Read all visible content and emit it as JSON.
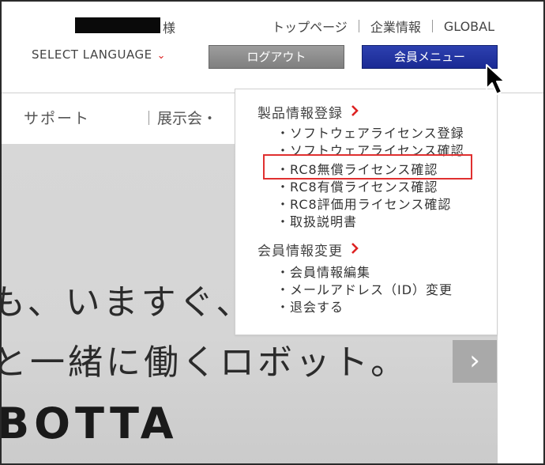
{
  "header": {
    "honorific": "様",
    "links": [
      "トップページ",
      "企業情報",
      "GLOBAL"
    ],
    "language_label": "SELECT LANGUAGE",
    "language_chevron": "⌄",
    "logout_label": "ログアウト",
    "member_menu_label": "会員メニュー"
  },
  "nav": {
    "support": "サポート",
    "exhibition": "展示会・"
  },
  "hero": {
    "line1": "も、いますぐ、た",
    "line2": "と一緒に働くロボット。",
    "brand": "BOTTA",
    "next_glyph": "›"
  },
  "dropdown": {
    "sections": [
      {
        "title": "製品情報登録",
        "items": [
          "・ソフトウェアライセンス登録",
          "・ソフトウェアライセンス確認",
          "・RC8無償ライセンス確認",
          "・RC8有償ライセンス確認",
          "・RC8評価用ライセンス確認",
          "・取扱説明書"
        ]
      },
      {
        "title": "会員情報変更",
        "items": [
          "・会員情報編集",
          "・メールアドレス（ID）変更",
          "・退会する"
        ]
      }
    ],
    "highlighted_item": "・RC8無償ライセンス確認"
  },
  "icons": {
    "section_arrow": "chevron-right-icon",
    "cursor": "mouse-pointer-icon",
    "next": "chevron-right-icon"
  },
  "colors": {
    "accent_red": "#d22222",
    "member_button": "#1f2f9e",
    "logout_button": "#8a8a8a",
    "highlight_border": "#e03030"
  }
}
